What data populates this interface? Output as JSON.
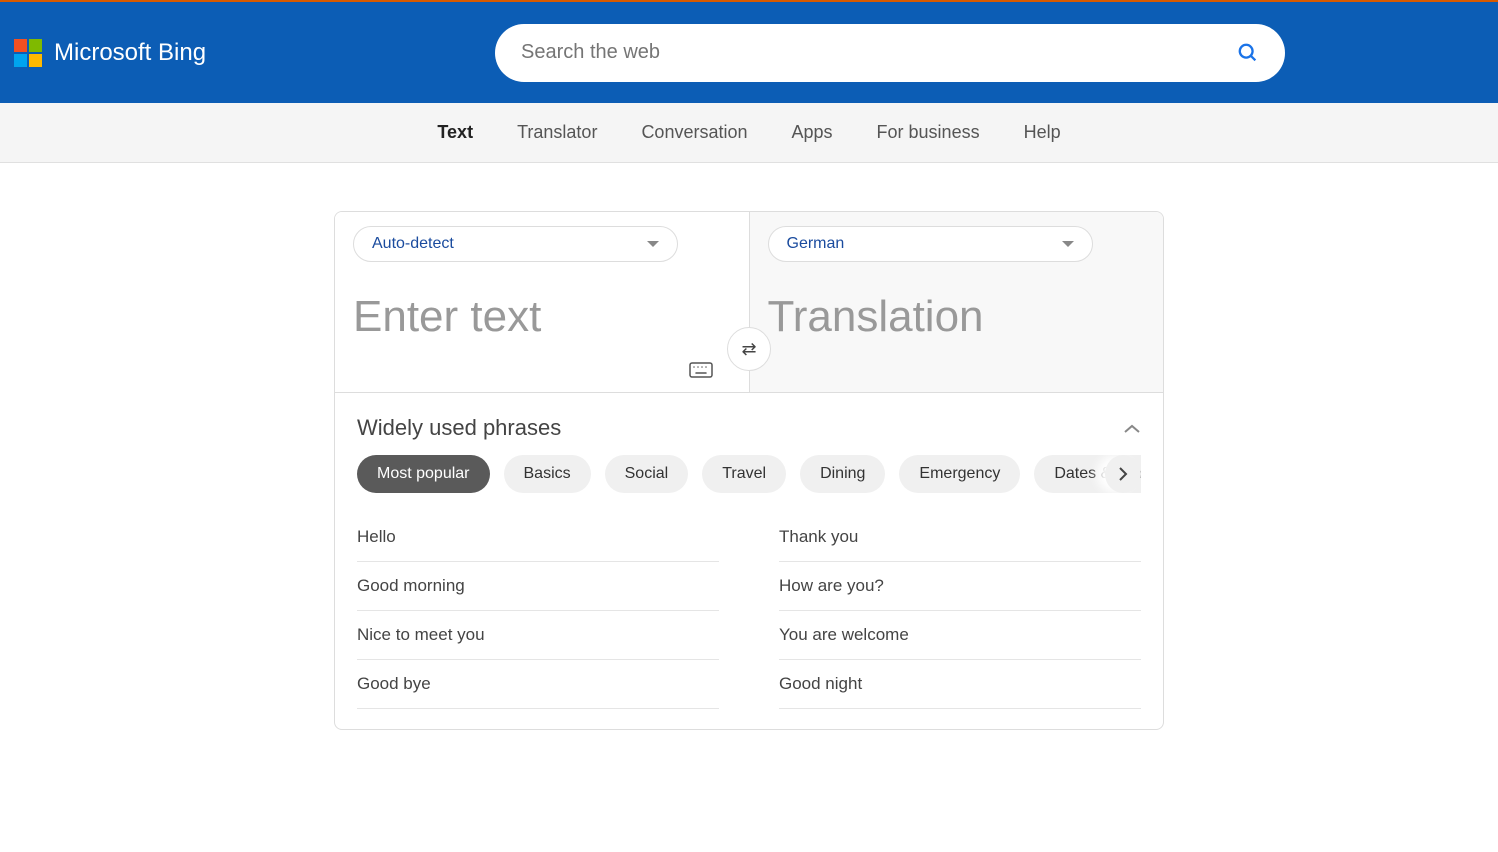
{
  "header": {
    "brand": "Microsoft Bing",
    "search_placeholder": "Search the web"
  },
  "nav": {
    "tabs": [
      "Text",
      "Translator",
      "Conversation",
      "Apps",
      "For business",
      "Help"
    ],
    "active": "Text"
  },
  "translator": {
    "source_lang": "Auto-detect",
    "target_lang": "German",
    "source_placeholder": "Enter text",
    "target_placeholder": "Translation"
  },
  "phrases": {
    "title": "Widely used phrases",
    "categories": [
      "Most popular",
      "Basics",
      "Social",
      "Travel",
      "Dining",
      "Emergency",
      "Dates & num"
    ],
    "active_category": "Most popular",
    "items": [
      "Hello",
      "Thank you",
      "Good morning",
      "How are you?",
      "Nice to meet you",
      "You are welcome",
      "Good bye",
      "Good night"
    ]
  }
}
